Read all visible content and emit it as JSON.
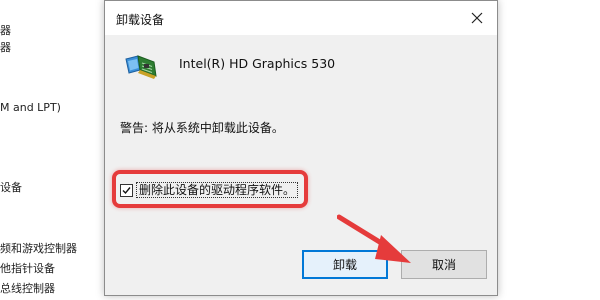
{
  "background": {
    "items": [
      "器",
      "器",
      "M and LPT)",
      "设备",
      "频和游戏控制器",
      "他指针设备",
      "总线控制器"
    ]
  },
  "dialog": {
    "title": "卸载设备",
    "device_name": "Intel(R) HD Graphics 530",
    "device_icon": "display-adapter-icon",
    "warning": "警告: 将从系统中卸载此设备。",
    "checkbox": {
      "label": "删除此设备的驱动程序软件。",
      "checked": true
    },
    "buttons": {
      "uninstall": "卸载",
      "cancel": "取消"
    }
  },
  "annotation": {
    "highlight_color": "#e53b3b",
    "arrow_color": "#e53b3b"
  }
}
